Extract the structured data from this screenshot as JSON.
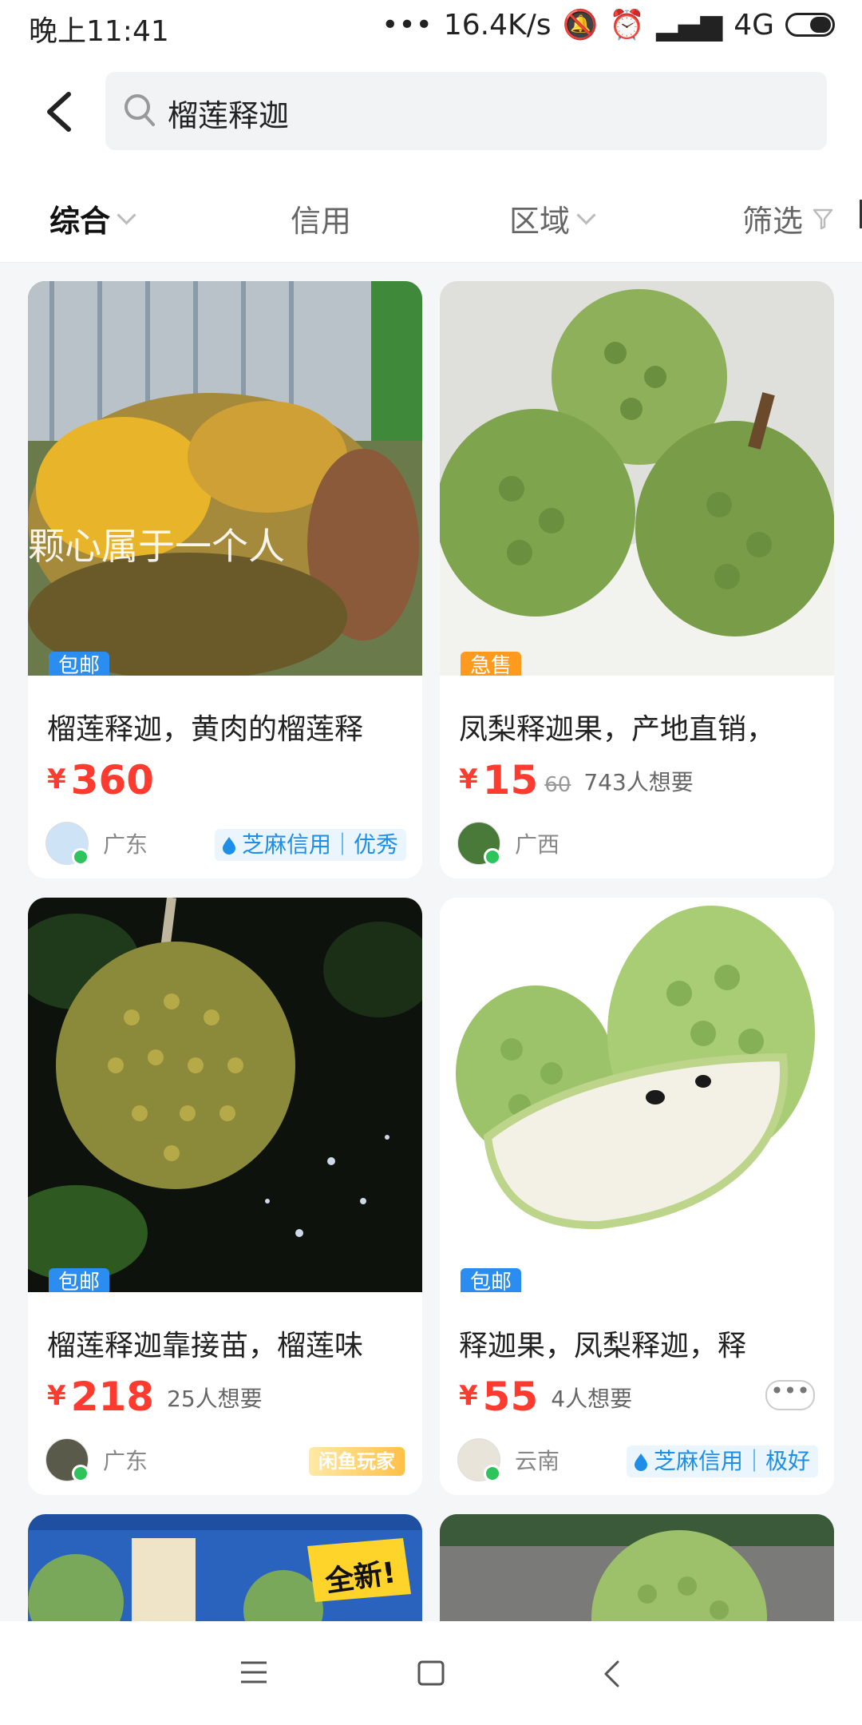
{
  "status_bar": {
    "time": "晚上11:41",
    "network_speed": "16.4K/s",
    "signal": "4G"
  },
  "search": {
    "query": "榴莲释迦"
  },
  "tabs": [
    {
      "label": "综合"
    },
    {
      "label": "信用"
    },
    {
      "label": "区域"
    },
    {
      "label": "筛选"
    }
  ],
  "products": [
    {
      "tag": "包邮",
      "title": "榴莲释迦，黄肉的榴莲释",
      "price": "360",
      "region": "广东",
      "credit": "芝麻信用｜优秀",
      "image_text": "颗心属于一个人"
    },
    {
      "tag": "急售",
      "title": "凤梨释迦果，产地直销，",
      "price": "15",
      "original_price": "60",
      "want": "743人想要",
      "region": "广西"
    },
    {
      "tag": "包邮",
      "title": "榴莲释迦靠接苗，榴莲味",
      "price": "218",
      "want": "25人想要",
      "region": "广东",
      "badge": "闲鱼玩家"
    },
    {
      "tag": "包邮",
      "title": "释迦果，凤梨释迦，释",
      "price": "55",
      "want": "4人想要",
      "region": "云南",
      "credit": "芝麻信用｜极好",
      "more": "•••"
    },
    {
      "image_text": "全新!"
    }
  ],
  "currency": "¥",
  "colors": {
    "price": "#ff3b30",
    "tag_blue": "#2c8df0",
    "tag_orange": "#ff9a1f",
    "credit": "#1e8fe8"
  }
}
